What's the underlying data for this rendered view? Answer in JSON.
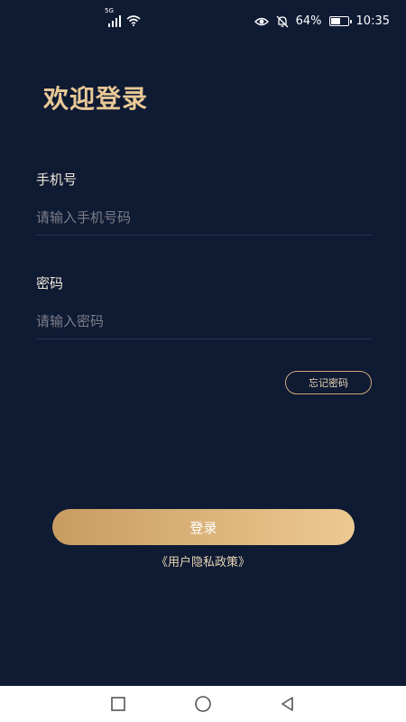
{
  "status": {
    "network": "5G",
    "battery_percent": "64%",
    "time": "10:35",
    "battery_level": 0.64
  },
  "page": {
    "title": "欢迎登录"
  },
  "form": {
    "phone_label": "手机号",
    "phone_placeholder": "请输入手机号码",
    "password_label": "密码",
    "password_placeholder": "请输入密码",
    "forgot_label": "忘记密码",
    "login_label": "登录",
    "policy_link": "《用户隐私政策》"
  },
  "colors": {
    "background": "#0f1a33",
    "accent": "#e8c996",
    "button_gradient_start": "#c89c61",
    "button_gradient_end": "#edc992"
  },
  "icons": [
    "signal-icon",
    "wifi-icon",
    "eye-icon",
    "mute-icon",
    "battery-icon",
    "recent-apps-icon",
    "home-icon",
    "back-icon"
  ]
}
